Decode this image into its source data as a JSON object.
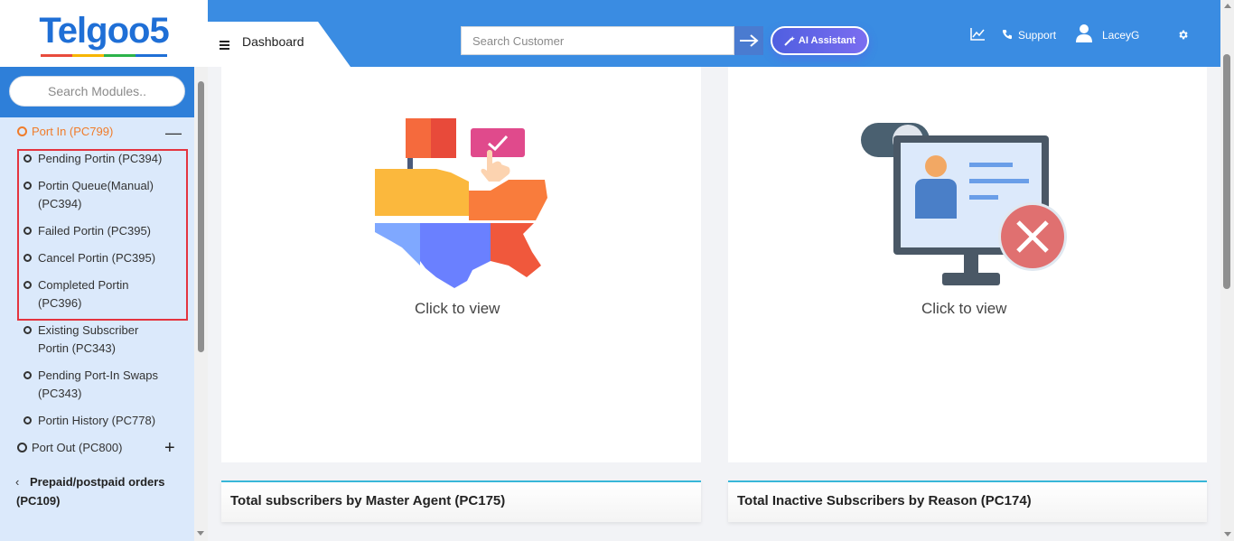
{
  "logo": {
    "text": "Telgoo5"
  },
  "sidebar": {
    "search_placeholder": "Search Modules..",
    "active_group": "Port In (PC799)",
    "items": [
      {
        "label": "Pending Portin (PC394)"
      },
      {
        "label": "Portin Queue(Manual)"
      },
      {
        "label": "(PC394)"
      },
      {
        "label": "Failed Portin (PC395)"
      },
      {
        "label": "Cancel Portin (PC395)"
      },
      {
        "label": "Completed Portin"
      },
      {
        "label": "(PC396)"
      },
      {
        "label": "Existing Subscriber"
      },
      {
        "label": "Portin (PC343)"
      },
      {
        "label": "Pending Port-In Swaps"
      },
      {
        "label": "(PC343)"
      },
      {
        "label": "Portin History (PC778)"
      }
    ],
    "port_out": "Port Out (PC800)",
    "prepaid_line1": "Prepaid/postpaid orders",
    "prepaid_line2": "(PC109)"
  },
  "header": {
    "tab_label": "Dashboard",
    "search_placeholder": "Search Customer",
    "ai_label": "AI Assistant",
    "support_label": "Support",
    "user_label": "LaceyG"
  },
  "cards": [
    {
      "click_label": "Click to view",
      "panel_title": "Total subscribers by Master Agent (PC175)"
    },
    {
      "click_label": "Click to view",
      "panel_title": "Total Inactive Subscribers by Reason (PC174)"
    }
  ],
  "colors": {
    "topbar": "#3a8ce2",
    "sidebar_bg": "#dbe9fb",
    "active_orange": "#f07c2a",
    "highlight_red": "#e4343f",
    "panel_accent": "#38b6d8"
  }
}
